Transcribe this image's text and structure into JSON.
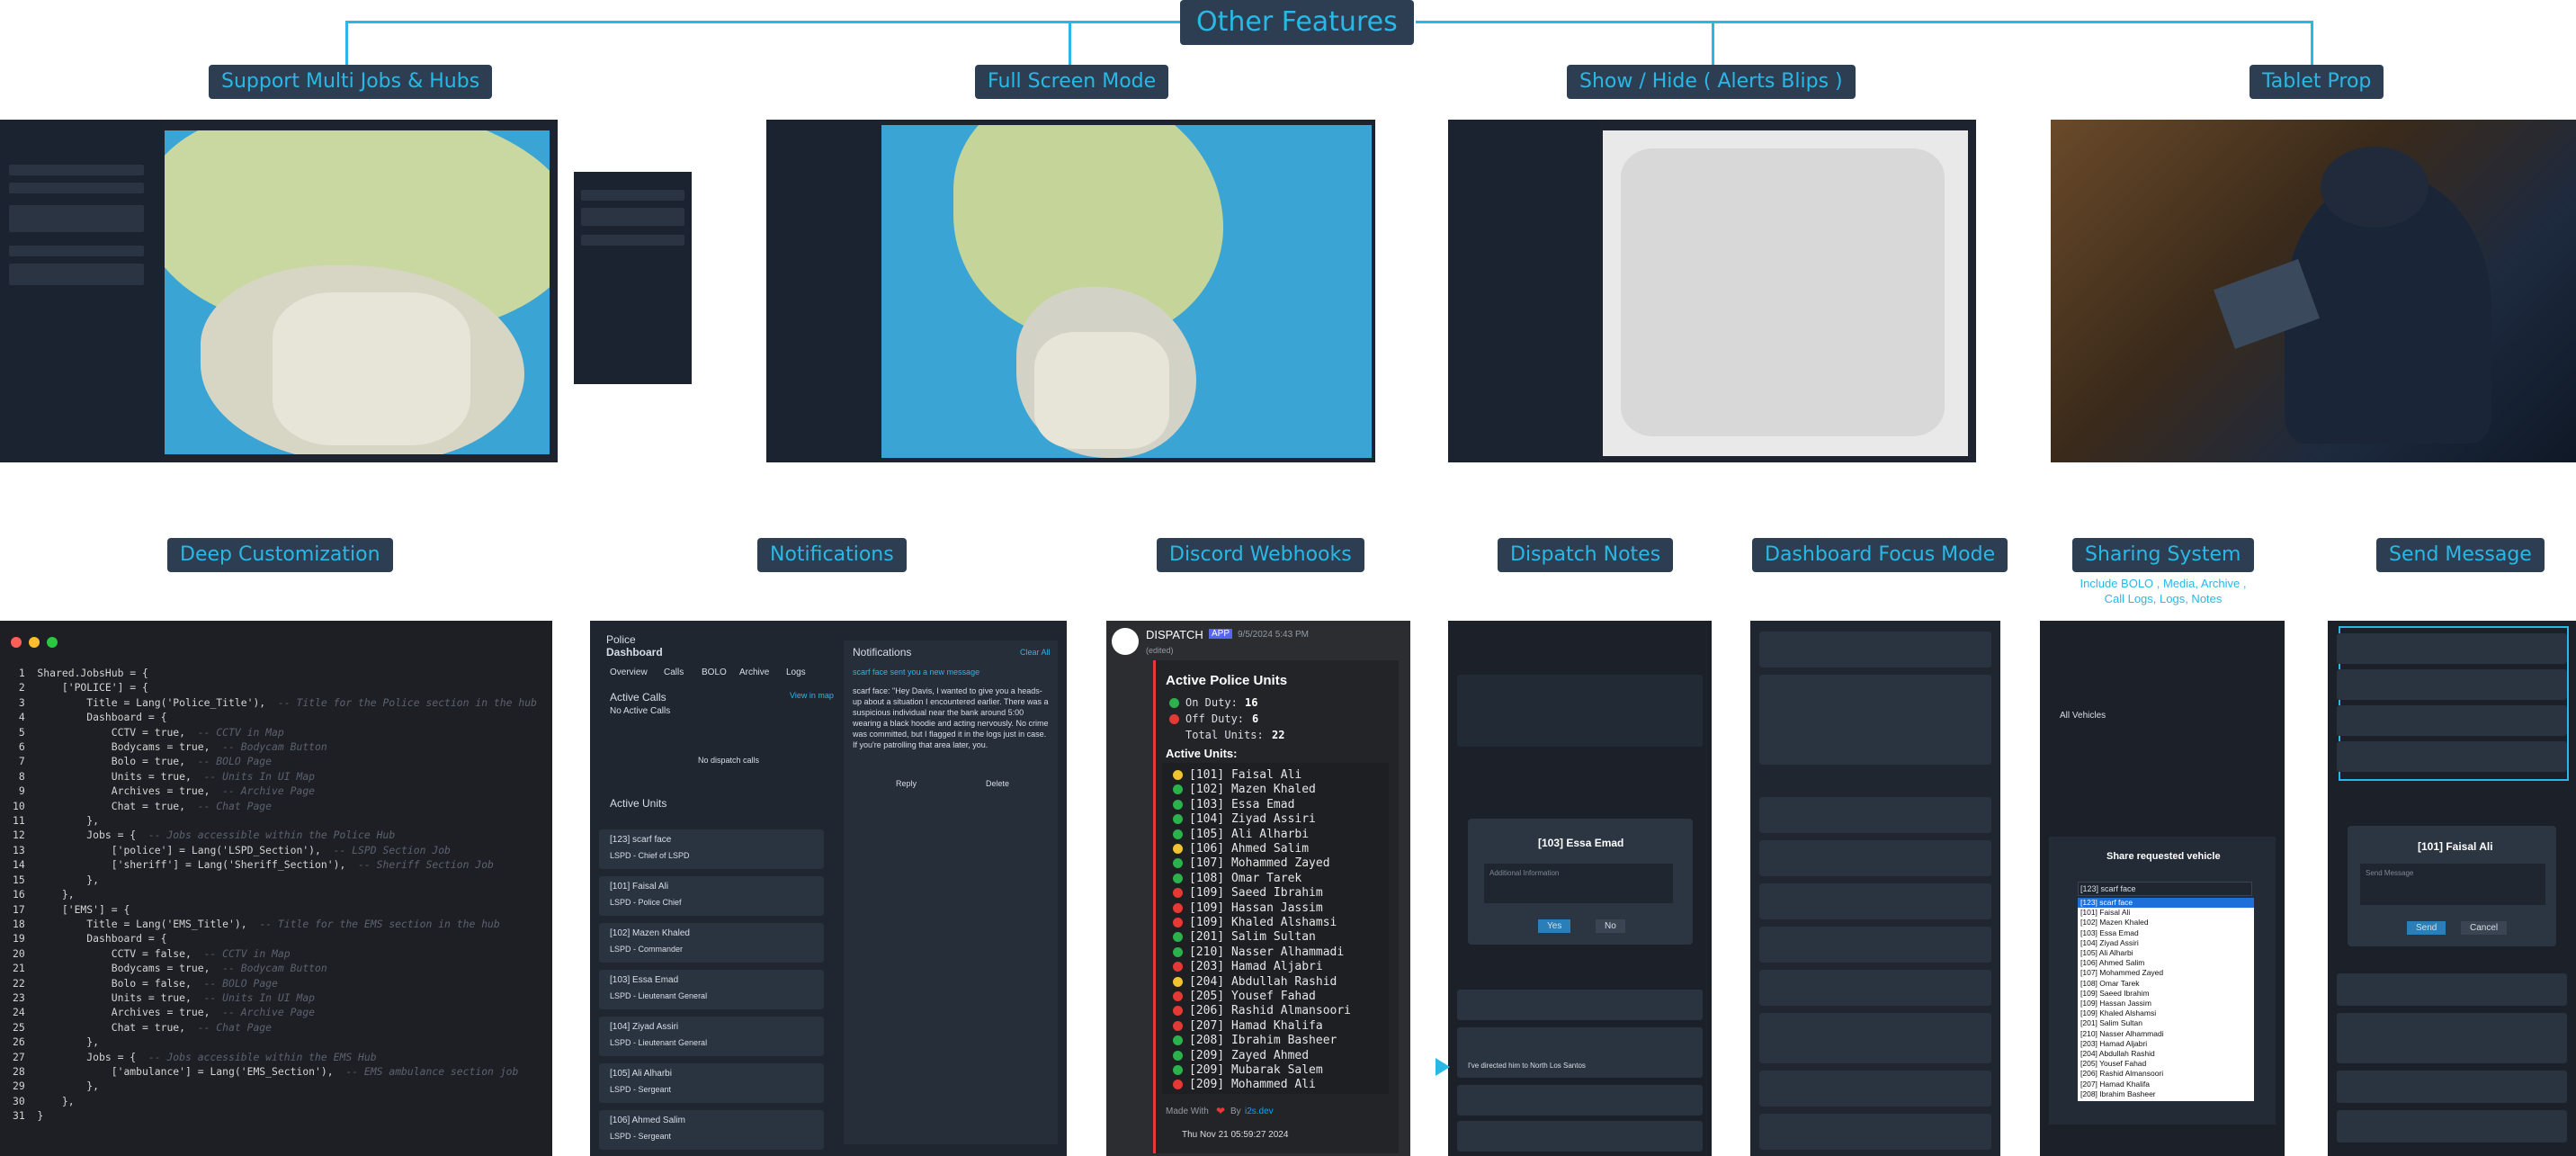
{
  "title": "Other Features",
  "features_row1": [
    {
      "label": "Support Multi Jobs & Hubs"
    },
    {
      "label": "Full Screen Mode"
    },
    {
      "label": "Show / Hide ( Alerts Blips )"
    },
    {
      "label": "Tablet Prop"
    }
  ],
  "features_row2": [
    {
      "label": "Deep Customization"
    },
    {
      "label": "Notifications"
    },
    {
      "label": "Discord Webhooks"
    },
    {
      "label": "Dispatch Notes"
    },
    {
      "label": "Dashboard Focus Mode"
    },
    {
      "label": "Sharing System"
    },
    {
      "label": "Send Message"
    }
  ],
  "sharing_subtitle": "Include BOLO , Media, Archive ,\nCall Logs, Logs, Notes",
  "code_lines": [
    "Shared.JobsHub = {",
    "    ['POLICE'] = {",
    "        Title = Lang('Police_Title'),  -- Title for the Police section in the hub",
    "        Dashboard = {",
    "            CCTV = true,  -- CCTV in Map",
    "            Bodycams = true,  -- Bodycam Button",
    "            Bolo = true,  -- BOLO Page",
    "            Units = true,  -- Units In UI Map",
    "            Archives = true,  -- Archive Page",
    "            Chat = true,  -- Chat Page",
    "        },",
    "        Jobs = {  -- Jobs accessible within the Police Hub",
    "            ['police'] = Lang('LSPD_Section'),  -- LSPD Section Job",
    "            ['sheriff'] = Lang('Sheriff_Section'),  -- Sheriff Section Job",
    "        },",
    "    },",
    "    ['EMS'] = {",
    "        Title = Lang('EMS_Title'),  -- Title for the EMS section in the hub",
    "        Dashboard = {",
    "            CCTV = false,  -- CCTV in Map",
    "            Bodycams = true,  -- Bodycam Button",
    "            Bolo = false,  -- BOLO Page",
    "            Units = true,  -- Units In UI Map",
    "            Archives = true,  -- Archive Page",
    "            Chat = true,  -- Chat Page",
    "        },",
    "        Jobs = {  -- Jobs accessible within the EMS Hub",
    "            ['ambulance'] = Lang('EMS_Section'),  -- EMS ambulance section job",
    "        },",
    "    },",
    "}"
  ],
  "notifications": {
    "app_title": "Police",
    "app_subtitle": "Dashboard",
    "tabs": [
      "Overview",
      "Calls",
      "BOLO",
      "Archive",
      "Logs"
    ],
    "active_calls": "Active Calls",
    "view_in_map": "View in map",
    "no_active_calls": "No Active Calls",
    "no_dispatch_calls": "No dispatch calls",
    "active_units": "Active Units",
    "notif_header": "Notifications",
    "clear_all": "Clear All",
    "notif_msg": "scarf face sent you a new message",
    "notif_body": "scarf face: \"Hey Davis, I wanted to give you a heads-up about a situation I encountered earlier. There was a suspicious individual near the bank around 5:00 wearing a black hoodie and acting nervously. No crime was committed, but I flagged it in the logs just in case. If you're patrolling that area later, you.",
    "reply": "Reply",
    "delete": "Delete",
    "units": [
      {
        "name": "[123] scarf face",
        "role": "LSPD - Chief of LSPD"
      },
      {
        "name": "[101] Faisal Ali",
        "role": "LSPD - Police Chief"
      },
      {
        "name": "[102] Mazen Khaled",
        "role": "LSPD - Commander"
      },
      {
        "name": "[103] Essa Emad",
        "role": "LSPD - Lieutenant General"
      },
      {
        "name": "[104] Ziyad Assiri",
        "role": "LSPD - Lieutenant General"
      },
      {
        "name": "[105] Ali Alharbi",
        "role": "LSPD - Sergeant"
      },
      {
        "name": "[106] Ahmed Salim",
        "role": "LSPD - Sergeant"
      }
    ]
  },
  "discord": {
    "bot": "DISPATCH",
    "app_tag": "APP",
    "time": "9/5/2024 5:43 PM",
    "edited": "(edited)",
    "title": "Active Police Units",
    "on_duty_label": "On Duty:",
    "on_duty": "16",
    "off_duty_label": "Off Duty:",
    "off_duty": "6",
    "total_label": "Total Units:",
    "total": "22",
    "units_label": "Active Units:",
    "units": [
      {
        "name": "[101] Faisal Ali",
        "color": "#f0c330"
      },
      {
        "name": "[102] Mazen Khaled",
        "color": "#2bb24c"
      },
      {
        "name": "[103] Essa Emad",
        "color": "#2bb24c"
      },
      {
        "name": "[104] Ziyad Assiri",
        "color": "#2bb24c"
      },
      {
        "name": "[105] Ali Alharbi",
        "color": "#2bb24c"
      },
      {
        "name": "[106] Ahmed Salim",
        "color": "#f0c330"
      },
      {
        "name": "[107] Mohammed Zayed",
        "color": "#2bb24c"
      },
      {
        "name": "[108] Omar Tarek",
        "color": "#2bb24c"
      },
      {
        "name": "[109] Saeed Ibrahim",
        "color": "#e53935"
      },
      {
        "name": "[109] Hassan Jassim",
        "color": "#e53935"
      },
      {
        "name": "[109] Khaled Alshamsi",
        "color": "#e53935"
      },
      {
        "name": "[201] Salim Sultan",
        "color": "#2bb24c"
      },
      {
        "name": "[210] Nasser Alhammadi",
        "color": "#2bb24c"
      },
      {
        "name": "[203] Hamad Aljabri",
        "color": "#e53935"
      },
      {
        "name": "[204] Abdullah Rashid",
        "color": "#f0c330"
      },
      {
        "name": "[205] Yousef Fahad",
        "color": "#e53935"
      },
      {
        "name": "[206] Rashid Almansoori",
        "color": "#e53935"
      },
      {
        "name": "[207] Hamad Khalifa",
        "color": "#e53935"
      },
      {
        "name": "[208] Ibrahim Basheer",
        "color": "#2bb24c"
      },
      {
        "name": "[209] Zayed Ahmed",
        "color": "#2bb24c"
      },
      {
        "name": "[209] Mubarak Salem",
        "color": "#2bb24c"
      },
      {
        "name": "[209] Mohammed Ali",
        "color": "#e53935"
      }
    ],
    "footer_made": "Made With",
    "footer_by": "By",
    "footer_author": "i2s.dev",
    "footer_time": "Thu Nov 21 05:59:27 2024"
  },
  "dispatch_notes": {
    "modal_title": "[103] Essa Emad",
    "placeholder": "Additional Information",
    "yes": "Yes",
    "no": "No",
    "note": "I've directed him to North Los Santos"
  },
  "sharing": {
    "modal_title": "Share requested vehicle",
    "selected": "[123] scarf face",
    "options": [
      "[123] scarf face",
      "[101] Faisal Ali",
      "[102] Mazen Khaled",
      "[103] Essa Emad",
      "[104] Ziyad Assiri",
      "[105] Ali Alharbi",
      "[106] Ahmed Salim",
      "[107] Mohammed Zayed",
      "[108] Omar Tarek",
      "[109] Saeed Ibrahim",
      "[109] Hassan Jassim",
      "[109] Khaled Alshamsi",
      "[201] Salim Sultan",
      "[210] Nasser Alhammadi",
      "[203] Hamad Aljabri",
      "[204] Abdullah Rashid",
      "[205] Yousef Fahad",
      "[206] Rashid Almansoori",
      "[207] Hamad Khalifa",
      "[208] Ibrahim Basheer"
    ],
    "section": "All Vehicles"
  },
  "send_message": {
    "modal_title": "[101] Faisal Ali",
    "placeholder": "Send Message",
    "send": "Send",
    "cancel": "Cancel"
  },
  "colors": {
    "accent": "#29b8e6",
    "label_bg": "#2d3e52"
  }
}
